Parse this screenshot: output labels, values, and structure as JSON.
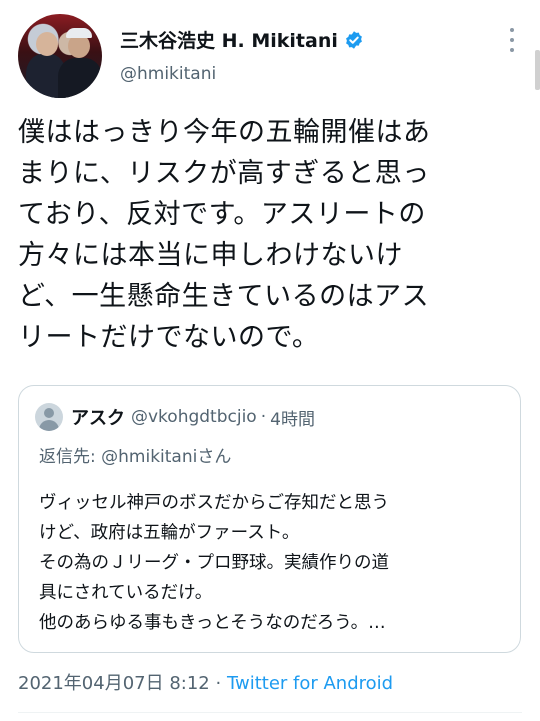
{
  "author": {
    "display_name": "三木谷浩史 H. Mikitani",
    "handle": "@hmikitani",
    "verified": true,
    "avatar_icon": "profile-photo"
  },
  "tweet": {
    "lines": [
      "僕ははっきり今年の五輪開催はあ",
      "まりに、リスクが高すぎると思っ",
      "ており、反対です。アスリートの",
      "方々には本当に申しわけないけ",
      "ど、一生懸命生きているのはアス",
      "リートだけでないので。"
    ]
  },
  "quoted": {
    "name": "アスク",
    "handle": "@vkohgdtbcjio",
    "separator": "·",
    "time": "4時間",
    "reply_to_label": "返信先: @hmikitaniさん",
    "lines": [
      "ヴィッセル神戸のボスだからご存知だと思う",
      "けど、政府は五輪がファースト。",
      "その為のＪリーグ・プロ野球。実績作りの道",
      "具にされているだけ。",
      "他のあらゆる事もきっとそうなのだろう。…"
    ]
  },
  "meta": {
    "timestamp": "2021年04月07日 8:12",
    "separator": "·",
    "source": "Twitter for Android"
  },
  "colors": {
    "verified_blue": "#1d9bf0",
    "link_blue": "#1d9bf0",
    "secondary_text": "#536471",
    "border": "#cfd9de"
  }
}
